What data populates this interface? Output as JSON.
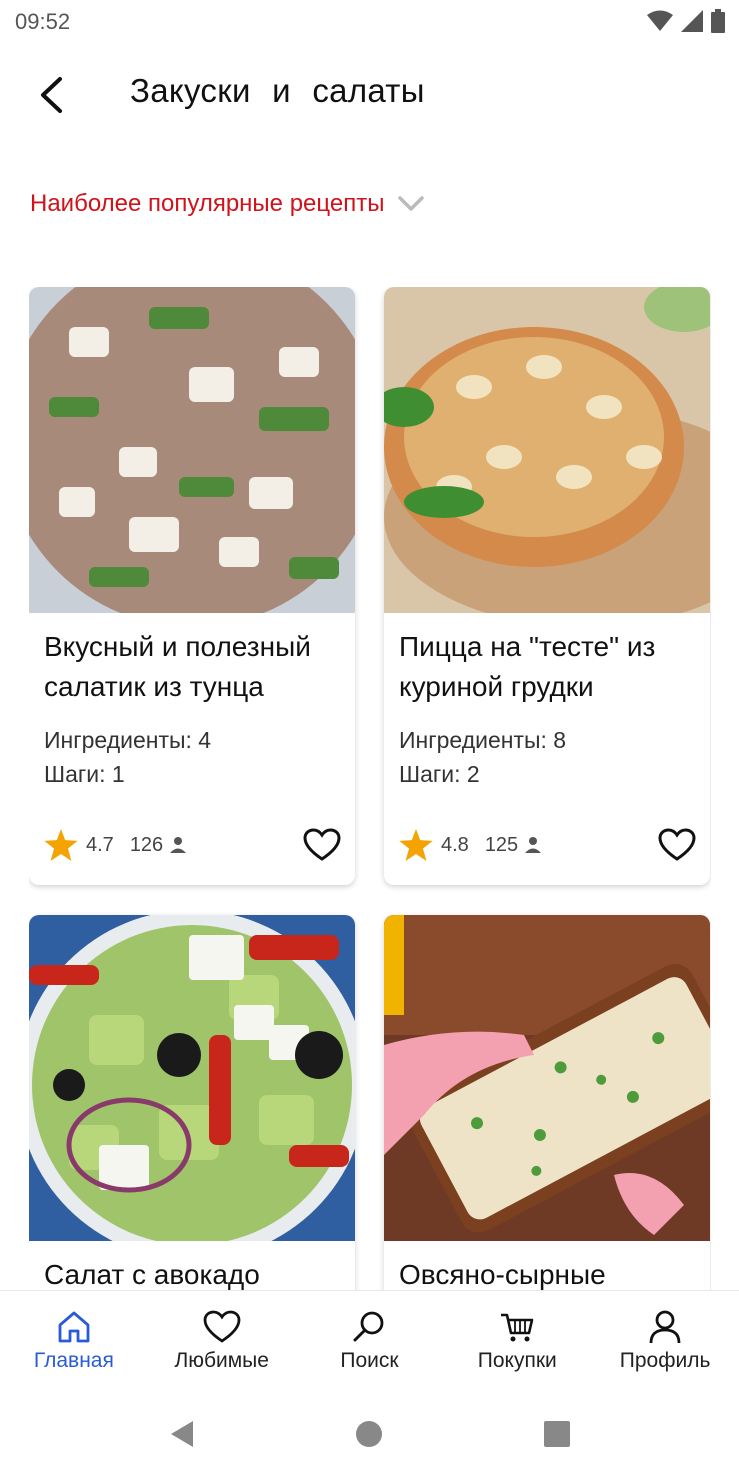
{
  "status_bar": {
    "time": "09:52"
  },
  "header": {
    "title": "Закуски и салаты",
    "back_icon": "back-arrow-icon"
  },
  "sort": {
    "label": "Наиболее популярные рецепты"
  },
  "recipes": [
    {
      "title": "Вкусный и полезный салатик из тунца",
      "ingredients": "Ингредиенты: 4",
      "steps": "Шаги: 1",
      "rating": "4.7",
      "votes": "126"
    },
    {
      "title": "Пицца на \"тесте\" из куриной грудки",
      "ingredients": "Ингредиенты: 8",
      "steps": "Шаги: 2",
      "rating": "4.8",
      "votes": "125"
    },
    {
      "title": "Салат с авокадо",
      "ingredients": "",
      "steps": "",
      "rating": "",
      "votes": ""
    },
    {
      "title": "Овсяно-сырные",
      "ingredients": "",
      "steps": "",
      "rating": "",
      "votes": ""
    }
  ],
  "bottom_nav": [
    {
      "label": "Главная",
      "icon": "home-icon",
      "active": true
    },
    {
      "label": "Любимые",
      "icon": "heart-icon",
      "active": false
    },
    {
      "label": "Поиск",
      "icon": "search-icon",
      "active": false
    },
    {
      "label": "Покупки",
      "icon": "cart-icon",
      "active": false
    },
    {
      "label": "Профиль",
      "icon": "profile-icon",
      "active": false
    }
  ],
  "colors": {
    "accent": "#d0121b",
    "nav_active": "#2a5bd7",
    "star": "#f5a300"
  }
}
